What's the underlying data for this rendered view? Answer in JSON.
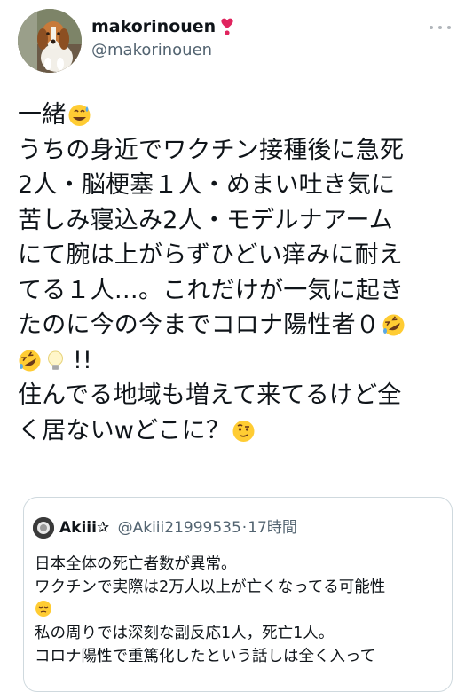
{
  "author": {
    "display_name": "makorinouen",
    "handle": "@makorinouen"
  },
  "tweet": {
    "lines": [
      "一緒",
      "うちの身近でワクチン接種後に急死",
      "2人・脳梗塞１人・めまい吐き気に",
      "苦しみ寝込み2人・モデルナアーム",
      "にて腕は上がらずひどい痒みに耐え",
      "てる１人…。これだけが一気に起き",
      "たのに今の今までコロナ陽性者０",
      "!!",
      "住んでる地域も増えて来てるけど全",
      "く居ないwどこに？"
    ]
  },
  "quote": {
    "display_name": "Akiii✰",
    "handle": "@Akiii21999535",
    "separator": "·",
    "time": "17時間",
    "lines": [
      "日本全体の死亡者数が異常。",
      "ワクチンで実際は2万人以上が亡くなってる可能性",
      "",
      "私の周りでは深刻な副反応1人，死亡1人。",
      "コロナ陽性で重篤化したという話しは全く入って"
    ]
  },
  "icons": {
    "heart": "red-heart-icon",
    "more": "more-icon",
    "emoji_sweat": "grinning-sweat-emoji",
    "emoji_rofl": "rofl-emoji",
    "emoji_bulb": "light-bulb-emoji",
    "emoji_raised_eyebrow": "raised-eyebrow-emoji",
    "emoji_pensive": "pensive-emoji"
  },
  "colors": {
    "text": "#0f1419",
    "secondary": "#536471",
    "border": "#cfd9de",
    "heart": "#e0245e"
  }
}
